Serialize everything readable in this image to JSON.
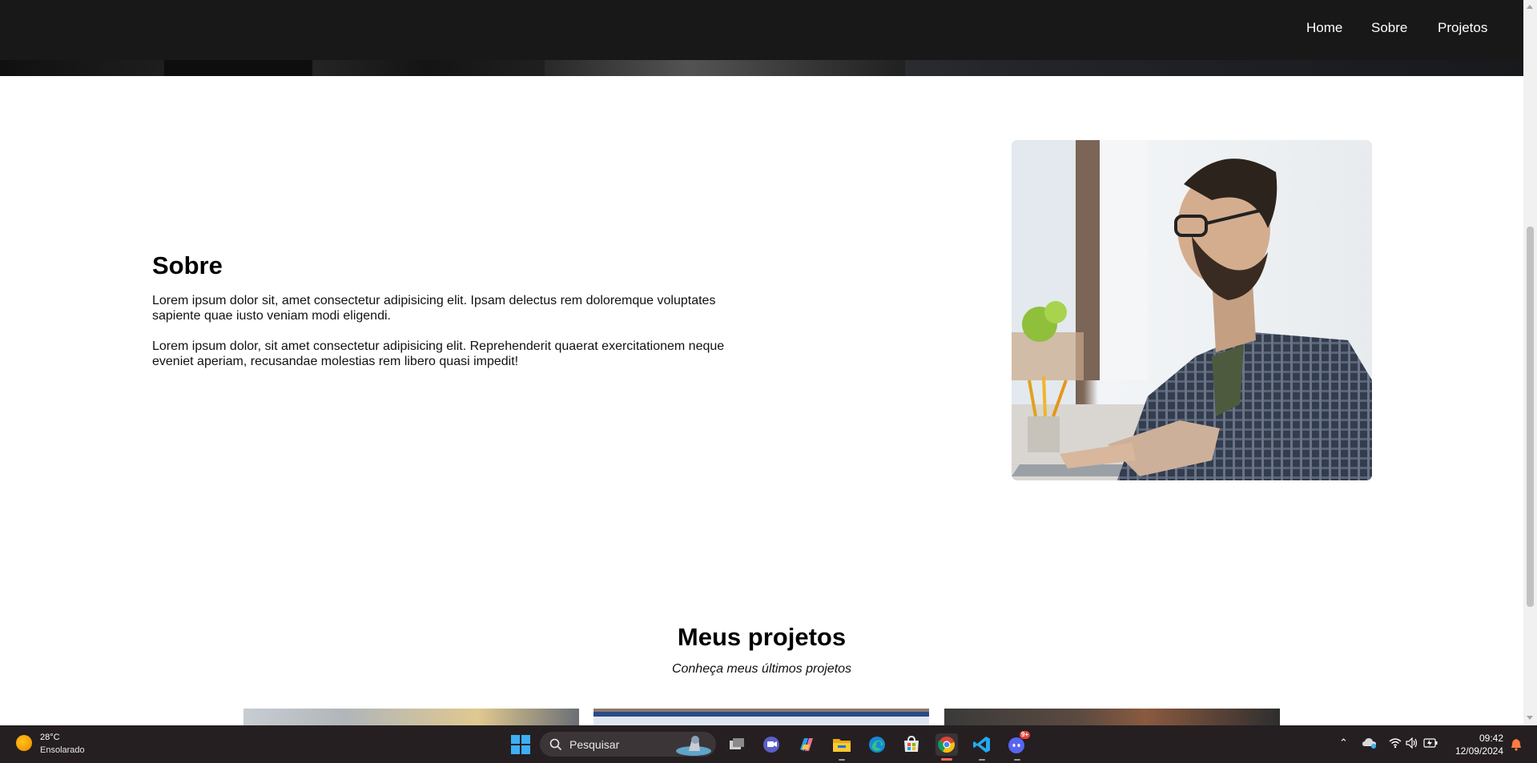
{
  "nav": {
    "items": [
      {
        "label": "Home"
      },
      {
        "label": "Sobre"
      },
      {
        "label": "Projetos"
      }
    ]
  },
  "about": {
    "title": "Sobre",
    "paragraphs": [
      "Lorem ipsum dolor sit, amet consectetur adipisicing elit. Ipsam delectus rem doloremque voluptates sapiente quae iusto veniam modi eligendi.",
      "Lorem ipsum dolor, sit amet consectetur adipisicing elit. Reprehenderit quaerat exercitationem neque eveniet aperiam, recusandae molestias rem libero quasi impedit!"
    ],
    "image": "man-with-glasses-typing-on-laptop"
  },
  "projects": {
    "title": "Meus projetos",
    "subtitle": "Conheça meus últimos projetos",
    "cards": [
      "project-card-1",
      "project-card-2",
      "project-card-3"
    ]
  },
  "taskbar": {
    "weather": {
      "temp": "28°C",
      "condition": "Ensolarado",
      "icon": "sun-icon"
    },
    "search_placeholder": "Pesquisar",
    "apps": [
      "task-view-icon",
      "teams-icon",
      "copilot-icon",
      "file-explorer-icon",
      "edge-icon",
      "store-icon",
      "chrome-icon",
      "vscode-icon",
      "discord-icon"
    ],
    "discord_badge": "9+",
    "clock": {
      "time": "09:42",
      "date": "12/09/2024"
    }
  },
  "colors": {
    "navbar_bg": "#181818",
    "taskbar_bg": "#251f21",
    "accent_windows": "#3bb0f5",
    "chrome_active": "#ff6a60"
  }
}
